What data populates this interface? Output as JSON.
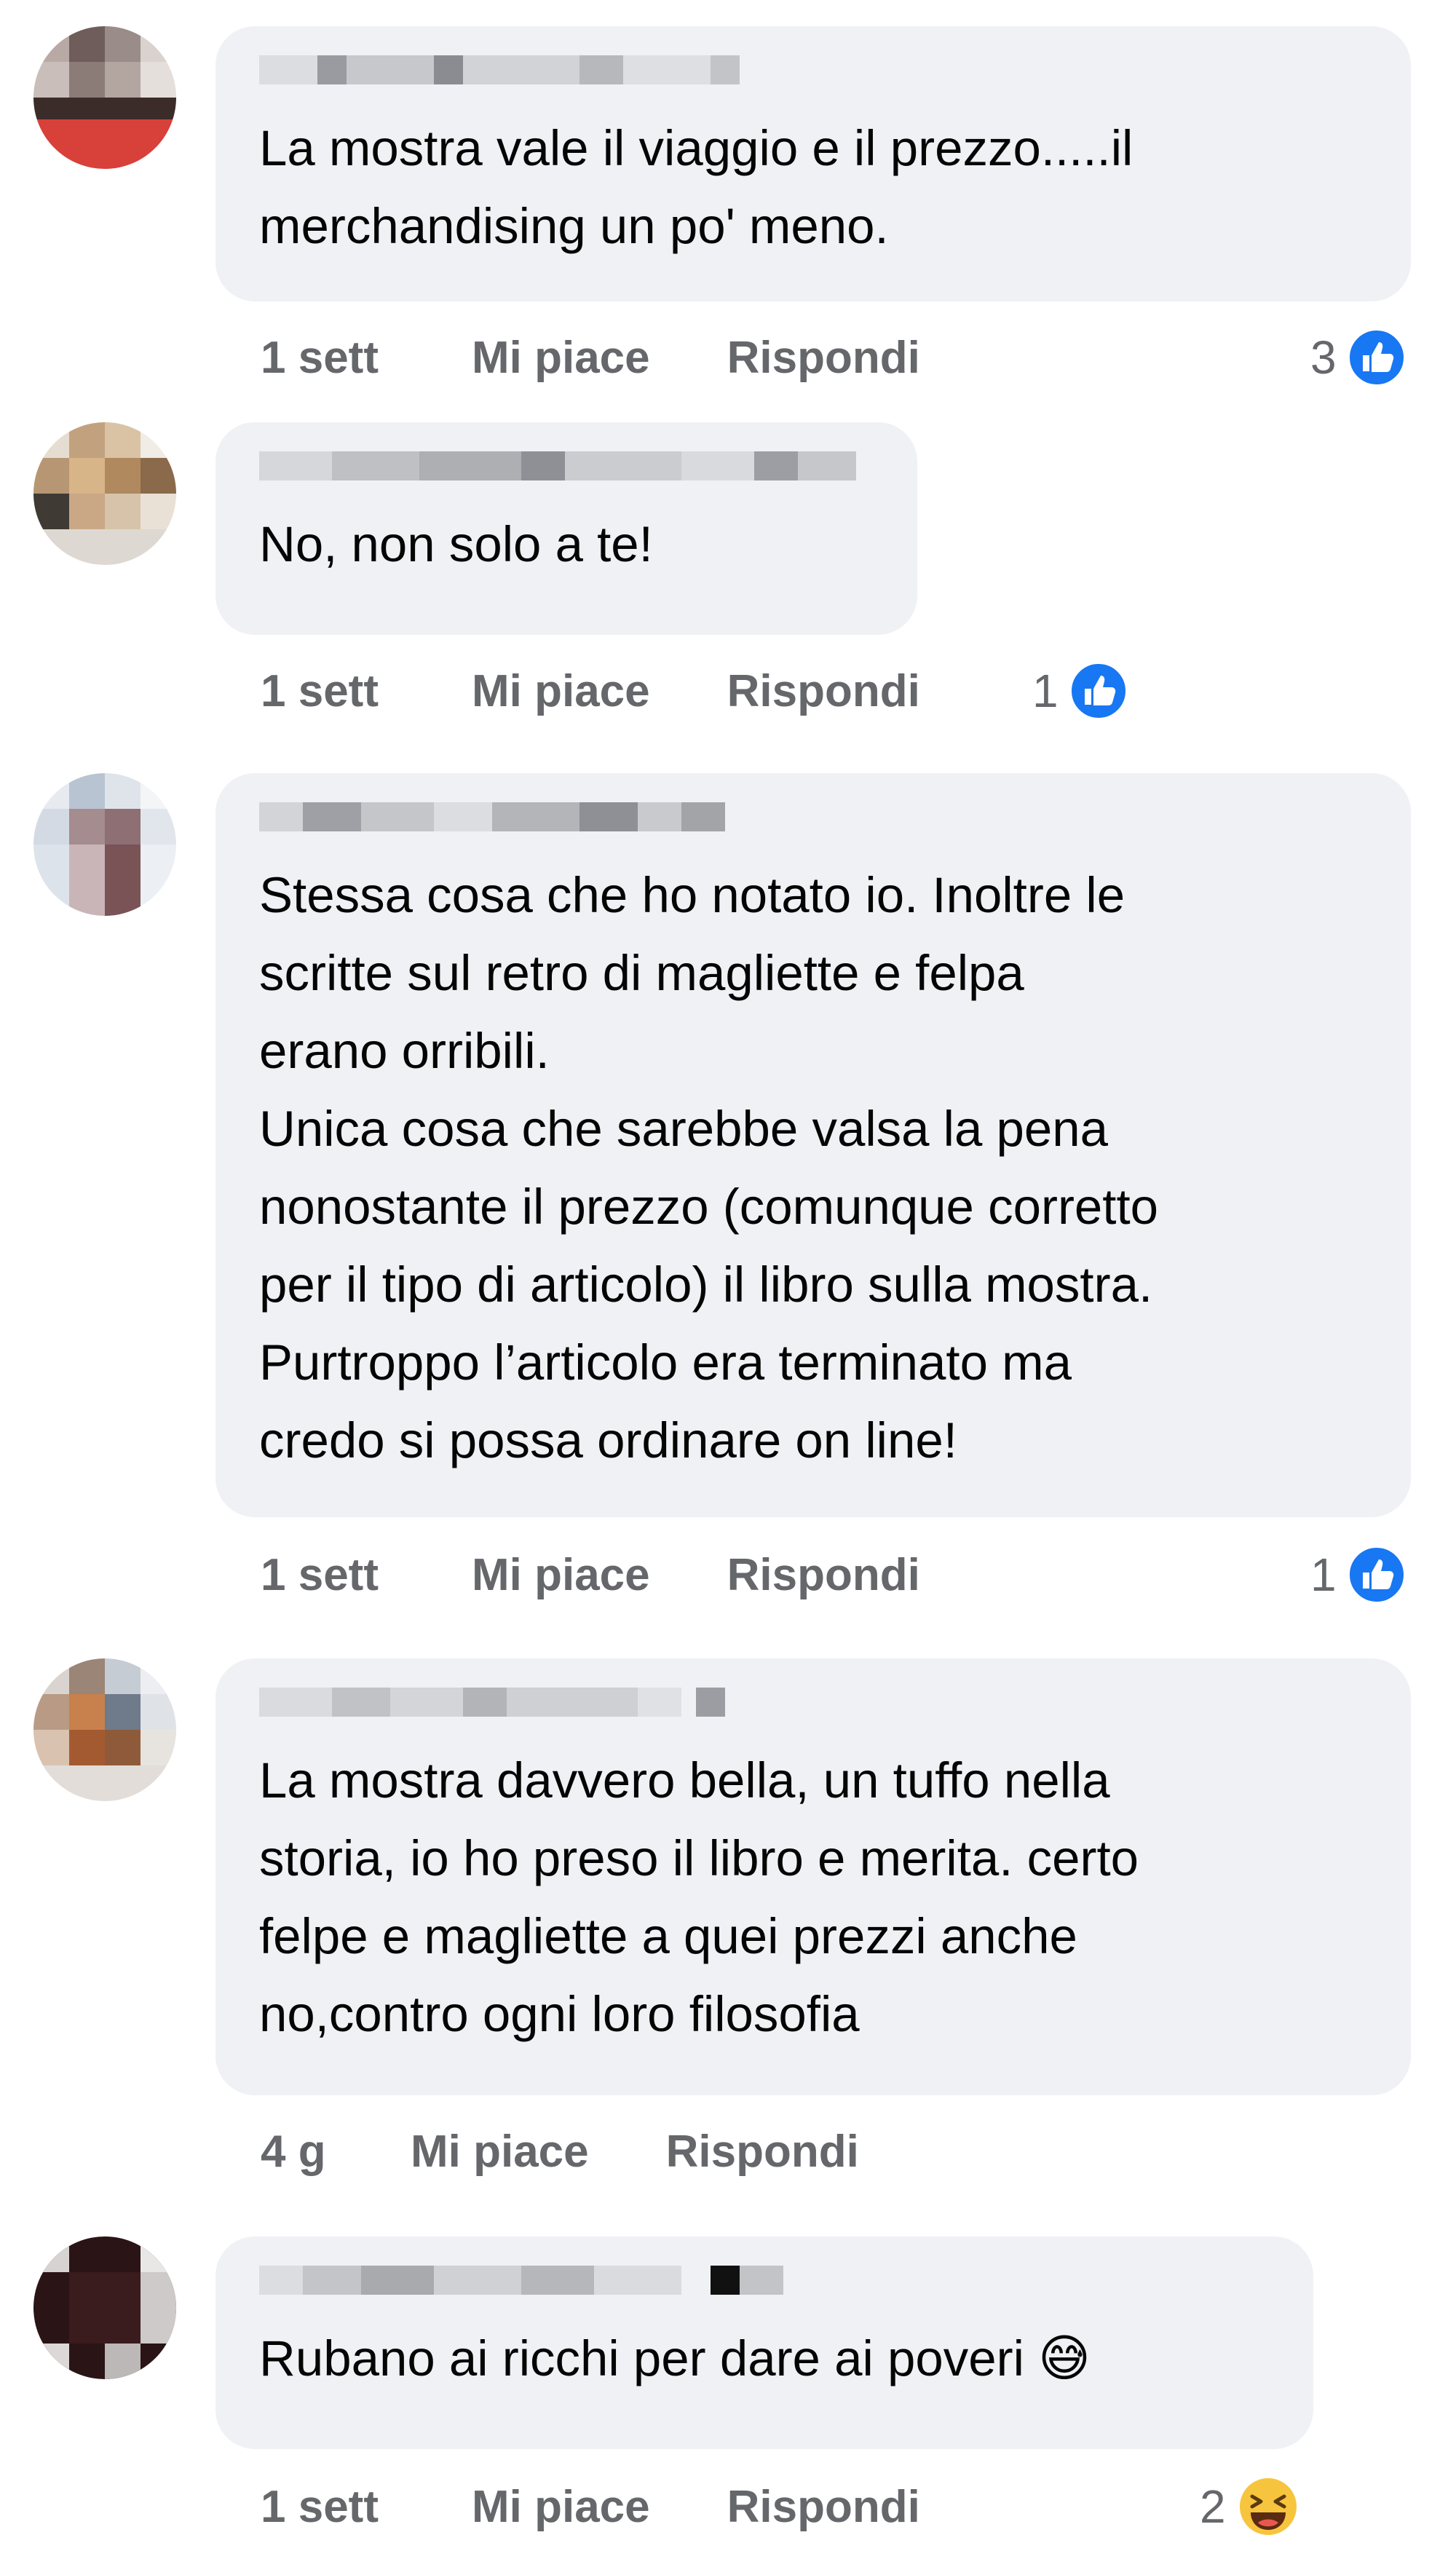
{
  "actions": {
    "like": "Mi piace",
    "reply": "Rispondi"
  },
  "colors": {
    "bubble": "#eff1f4",
    "meta_text": "#65676b",
    "like_blue": "#1877f2"
  },
  "comments": [
    {
      "time": "1 sett",
      "text": "La mostra vale il viaggio e il prezzo.....il\nmerchandising un po' meno.",
      "reaction": {
        "type": "like-icon",
        "count": "3"
      }
    },
    {
      "time": "1 sett",
      "text": "No, non solo a te!",
      "reaction": {
        "type": "like-icon",
        "count": "1"
      }
    },
    {
      "time": "1 sett",
      "text": "Stessa cosa che ho notato io. Inoltre le\nscritte sul retro di magliette e felpa\nerano orribili.\nUnica cosa che sarebbe valsa la pena\nnonostante il prezzo (comunque corretto\nper il tipo di articolo) il libro sulla mostra.\nPurtroppo l’articolo era terminato ma\ncredo si possa ordinare on line!",
      "reaction": {
        "type": "like-icon",
        "count": "1"
      }
    },
    {
      "time": "4 g",
      "text": "La mostra davvero bella, un tuffo nella\nstoria, io ho preso il libro e merita. certo\nfelpe e magliette a quei prezzi anche\nno,contro ogni loro filosofia",
      "reaction": null
    },
    {
      "time": "1 sett",
      "text": "Rubano ai ricchi per dare ai poveri 😅",
      "reaction": {
        "type": "laugh-icon",
        "count": "2"
      }
    }
  ]
}
